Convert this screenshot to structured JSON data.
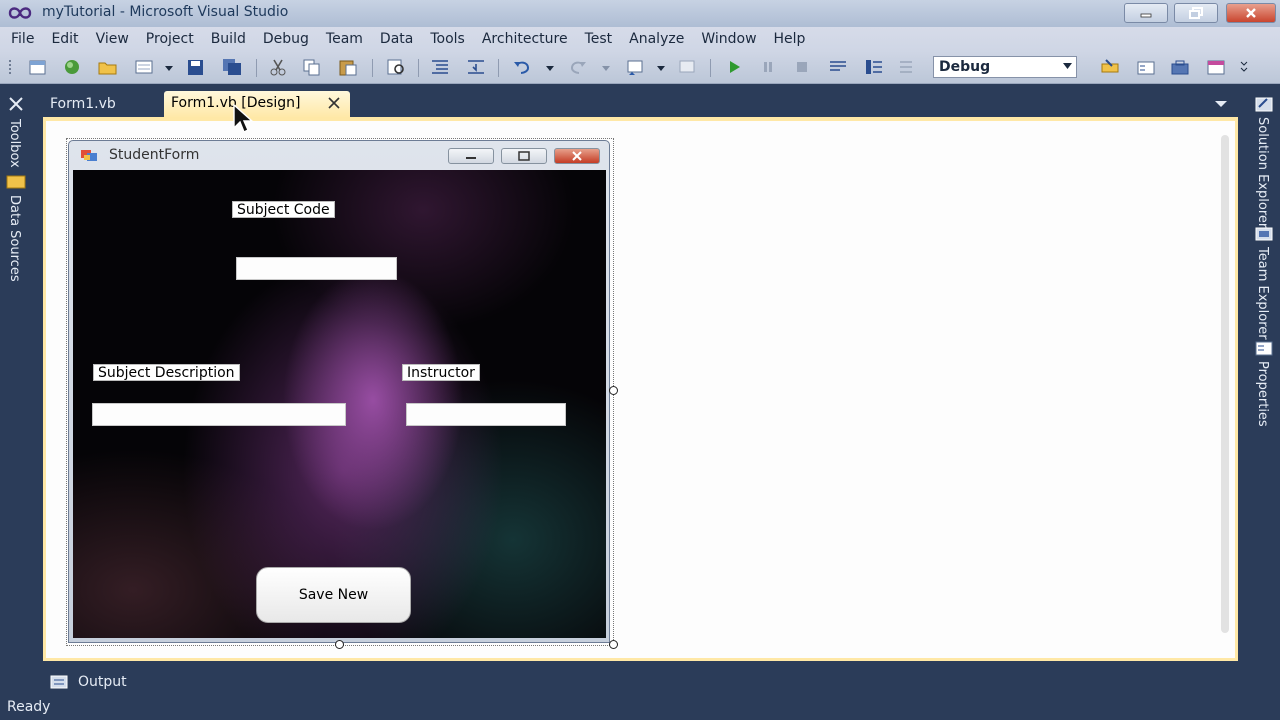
{
  "window": {
    "title": "myTutorial - Microsoft Visual Studio"
  },
  "menu": {
    "items": [
      "File",
      "Edit",
      "View",
      "Project",
      "Build",
      "Debug",
      "Team",
      "Data",
      "Tools",
      "Architecture",
      "Test",
      "Analyze",
      "Window",
      "Help"
    ]
  },
  "toolbar": {
    "configuration": "Debug",
    "icons": [
      "new-project-icon",
      "add-item-icon",
      "open-file-icon",
      "add-new-item-icon",
      "save-icon",
      "save-all-icon",
      "cut-icon",
      "copy-icon",
      "paste-icon",
      "find-icon",
      "comment-icon",
      "uncomment-icon",
      "undo-icon",
      "redo-icon",
      "navigate-icon",
      "run-icon",
      "pause-icon",
      "stop-icon",
      "step-icon",
      "solution-explorer-icon",
      "properties-icon",
      "toolbox-icon",
      "object-browser-icon"
    ]
  },
  "left_sidebar": {
    "tabs": [
      "Toolbox",
      "Data Sources"
    ]
  },
  "right_sidebar": {
    "tabs": [
      "Solution Explorer",
      "Team Explorer",
      "Properties"
    ]
  },
  "doc_tabs": {
    "code": "Form1.vb",
    "design": "Form1.vb [Design]"
  },
  "form": {
    "title": "StudentForm",
    "labels": {
      "subject_code": "Subject Code",
      "subject_description": "Subject Description",
      "instructor": "Instructor"
    },
    "save_button": "Save New"
  },
  "output": {
    "label": "Output"
  },
  "status": {
    "text": "Ready"
  },
  "colors": {
    "chrome": "#2b3c59",
    "active_tab": "#ffe8a6",
    "form_background": "#050407"
  }
}
